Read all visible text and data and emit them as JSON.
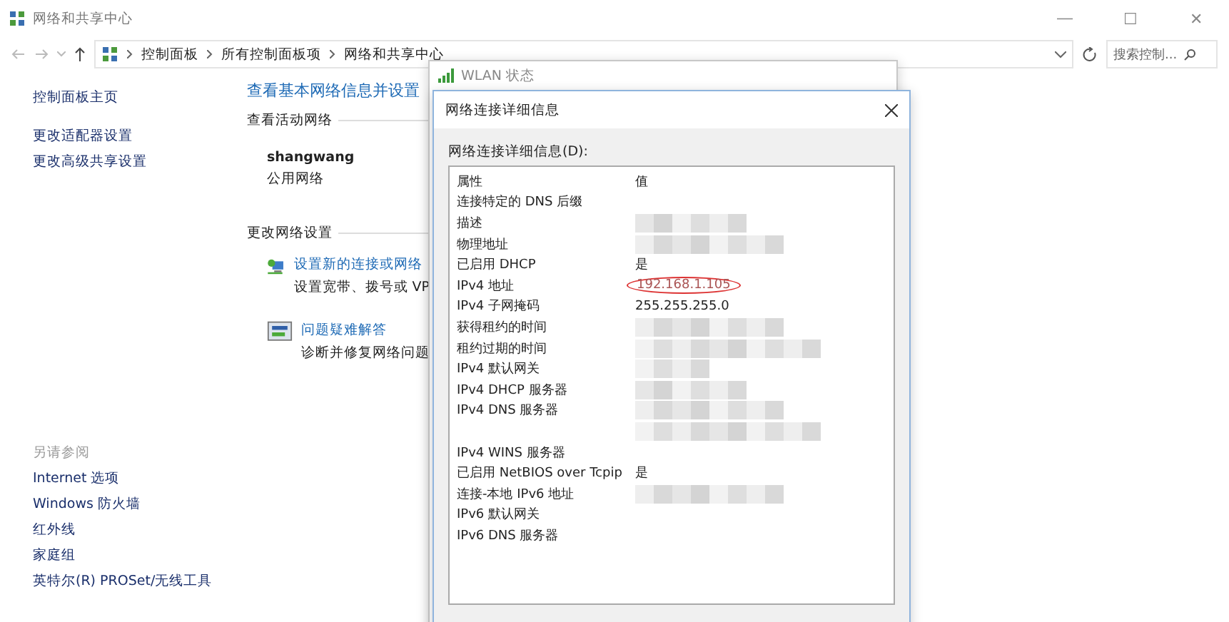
{
  "window": {
    "title": "网络和共享中心",
    "controls": [
      "—",
      "☐",
      "✕"
    ]
  },
  "address_bar": {
    "path": [
      "控制面板",
      "所有控制面板项",
      "网络和共享中心"
    ],
    "search_placeholder": "搜索控制..."
  },
  "sidebar": {
    "items": [
      {
        "label": "控制面板主页"
      },
      {
        "label": "更改适配器设置"
      },
      {
        "label": "更改高级共享设置"
      }
    ],
    "see_also_title": "另请参阅",
    "see_also": [
      {
        "label": "Internet 选项"
      },
      {
        "label": "Windows 防火墙"
      },
      {
        "label": "红外线"
      },
      {
        "label": "家庭组"
      },
      {
        "label": "英特尔(R) PROSet/无线工具"
      }
    ]
  },
  "main": {
    "heading": "查看基本网络信息并设置",
    "active_title": "查看活动网络",
    "network_name": "shangwang",
    "network_type": "公用网络",
    "change_title": "更改网络设置",
    "tasks": [
      {
        "kind": "setup",
        "link": "设置新的连接或网络",
        "description": "设置宽带、拨号或 VP"
      },
      {
        "kind": "troubleshoot",
        "link": "问题疑难解答",
        "description": "诊断并修复网络问题"
      }
    ]
  },
  "wlan_window": {
    "title": "WLAN 状态"
  },
  "details_dialog": {
    "title": "网络连接详细信息",
    "list_label": "网络连接详细信息(D):",
    "columns": [
      "属性",
      "值"
    ],
    "rows": [
      {
        "label": "连接特定的 DNS 后缀",
        "redacted": false
      },
      {
        "label": "描述",
        "redacted": true
      },
      {
        "label": "物理地址",
        "redacted": true
      },
      {
        "label": "已启用 DHCP",
        "value": "是",
        "redacted": false
      },
      {
        "label": "IPv4 地址",
        "value": "192.168.1.105",
        "redacted": false,
        "circled": true
      },
      {
        "label": "IPv4 子网掩码",
        "value": "255.255.255.0",
        "redacted": false
      },
      {
        "label": "获得租约的时间",
        "redacted": true
      },
      {
        "label": "租约过期的时间",
        "redacted": true
      },
      {
        "label": "IPv4 默认网关",
        "redacted": true
      },
      {
        "label": "IPv4 DHCP 服务器",
        "redacted": true
      },
      {
        "label": "IPv4 DNS 服务器",
        "redacted": true
      },
      {
        "redacted": true
      },
      {
        "label": "IPv4 WINS 服务器",
        "redacted": false
      },
      {
        "label": "已启用 NetBIOS over Tcpip",
        "value": "是",
        "redacted": false
      },
      {
        "label": "连接-本地 IPv6 地址",
        "redacted": true
      },
      {
        "label": "IPv6 默认网关",
        "redacted": false
      },
      {
        "label": "IPv6 DNS 服务器",
        "redacted": false
      }
    ]
  }
}
